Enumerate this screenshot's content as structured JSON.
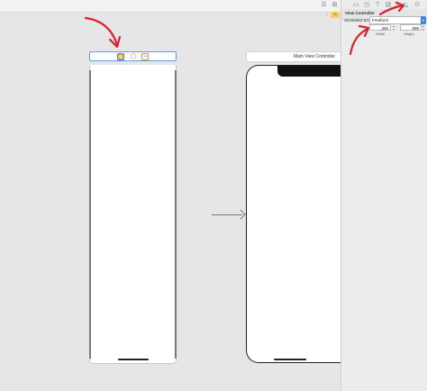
{
  "toolbar": {
    "icons": [
      "library-icon",
      "add-editor-icon"
    ]
  },
  "canvas": {
    "scene_icons": [
      "view-controller-icon",
      "first-responder-icon",
      "exit-icon"
    ],
    "main_scene_title": "Main View Controller",
    "segue": "initial-view-controller-arrow"
  },
  "inspector": {
    "tabs": [
      "file-inspector-icon",
      "history-icon",
      "quick-help-icon",
      "identity-icon",
      "attributes-icon",
      "size-inspector-icon",
      "connections-icon"
    ],
    "active_tab": "size-inspector-icon",
    "section_title": "View Controller",
    "simulated_size_label": "Simulated Size",
    "simulated_size_value": "Freeform",
    "width_value": "250",
    "width_label": "Width",
    "height_value": "896",
    "height_label": "Height"
  },
  "annotations": {
    "color": "#d9232b"
  }
}
